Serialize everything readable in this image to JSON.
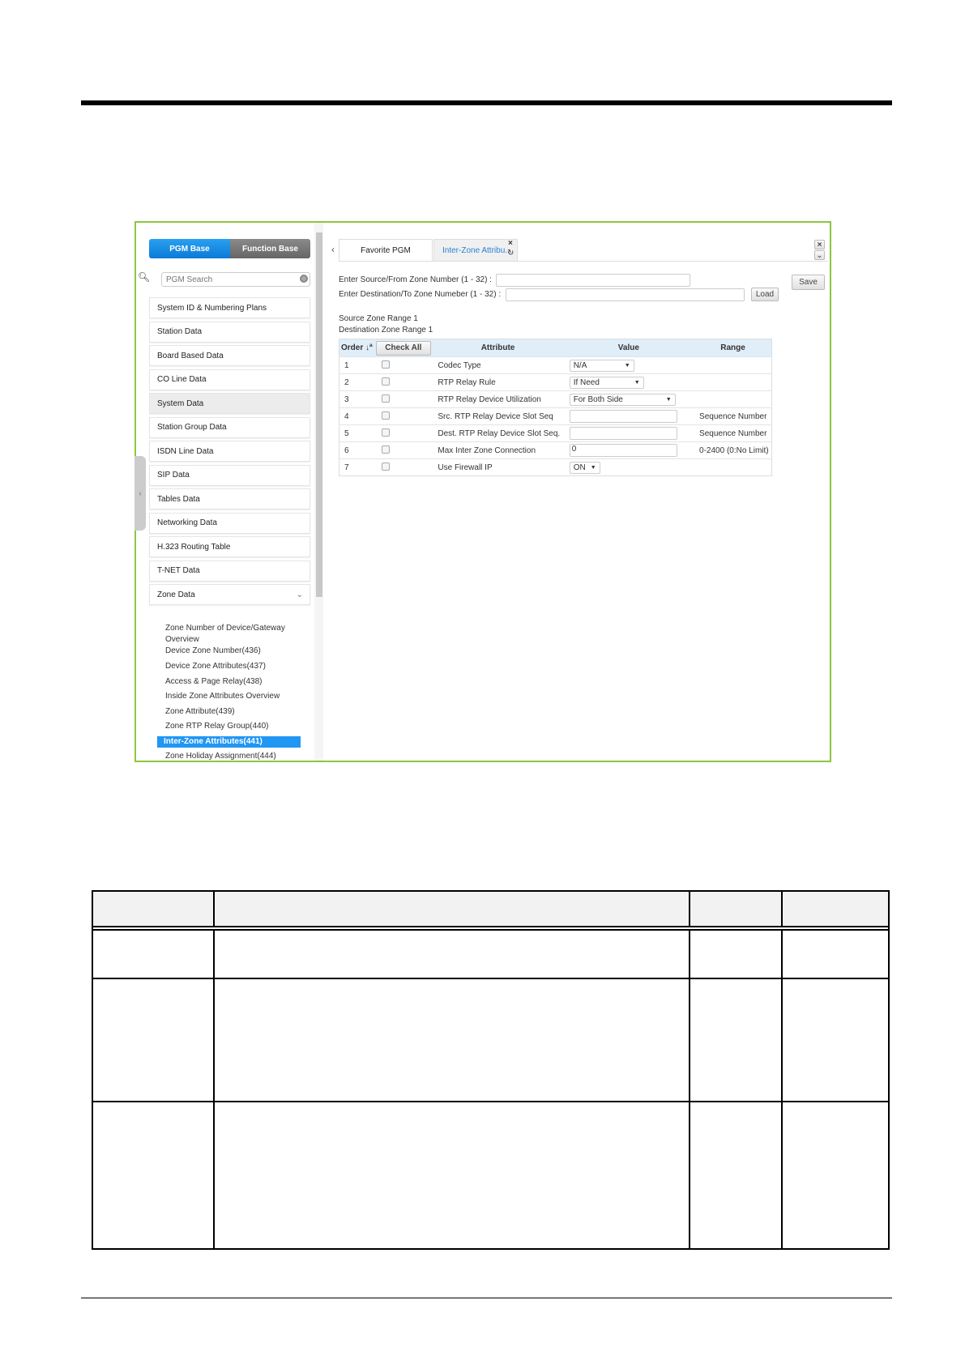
{
  "sidebar": {
    "toggle": {
      "pgm_base": "PGM Base",
      "function_base": "Function Base"
    },
    "search_placeholder": "PGM Search",
    "items": [
      "System ID & Numbering Plans",
      "Station Data",
      "Board Based Data",
      "CO Line Data",
      "System Data",
      "Station Group Data",
      "ISDN Line Data",
      "SIP Data",
      "Tables Data",
      "Networking Data",
      "H.323 Routing Table",
      "T-NET Data"
    ],
    "zone": {
      "label": "Zone Data",
      "subitems": [
        "Zone Number of Device/Gateway Overview",
        "Device Zone Number(436)",
        "Device Zone Attributes(437)",
        "Access & Page Relay(438)",
        "Inside Zone Attributes Overview",
        "Zone Attribute(439)",
        "Zone RTP Relay Group(440)",
        "Inter-Zone Attributes(441)",
        "Zone Holiday Assignment(444)"
      ]
    }
  },
  "tabs": {
    "favorite": "Favorite PGM",
    "active": "Inter-Zone Attribu..."
  },
  "form": {
    "source_label": "Enter Source/From Zone Number (1 - 32) :",
    "dest_label": "Enter Destination/To Zone Numeber (1 - 32) :",
    "source_value": "",
    "dest_value": "",
    "load": "Load",
    "save": "Save",
    "source_range": "Source Zone Range 1",
    "dest_range": "Destination Zone Range 1"
  },
  "grid": {
    "headers": {
      "order": "Order",
      "check_all": "Check All",
      "attribute": "Attribute",
      "value": "Value",
      "range": "Range"
    },
    "rows": [
      {
        "order": "1",
        "attribute": "Codec Type",
        "value": "N/A",
        "type": "select",
        "range": ""
      },
      {
        "order": "2",
        "attribute": "RTP Relay Rule",
        "value": "If Need",
        "type": "select",
        "range": ""
      },
      {
        "order": "3",
        "attribute": "RTP Relay Device Utilization",
        "value": "For Both Side",
        "type": "select",
        "range": ""
      },
      {
        "order": "4",
        "attribute": "Src. RTP Relay Device Slot Seq",
        "value": "",
        "type": "text",
        "range": "Sequence Number"
      },
      {
        "order": "5",
        "attribute": "Dest. RTP Relay Device Slot Seq.",
        "value": "",
        "type": "text",
        "range": "Sequence Number"
      },
      {
        "order": "6",
        "attribute": "Max Inter Zone Connection",
        "value": "0",
        "type": "text",
        "range": "0-2400 (0:No Limit)"
      },
      {
        "order": "7",
        "attribute": "Use Firewall IP",
        "value": "ON",
        "type": "select",
        "range": ""
      }
    ]
  },
  "colors": {
    "accent": "#2196f3",
    "frame": "#8cc63f"
  }
}
